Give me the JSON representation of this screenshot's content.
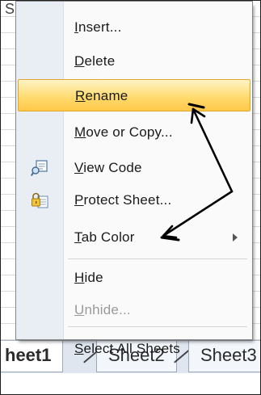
{
  "context_menu": {
    "items": [
      {
        "text": "Insert...",
        "accel": "I",
        "rest": "nsert...",
        "enabled": true
      },
      {
        "text": "Delete",
        "accel": "D",
        "rest": "elete",
        "enabled": true
      },
      {
        "text": "Rename",
        "accel": "R",
        "rest": "ename",
        "enabled": true,
        "highlighted": true
      },
      {
        "text": "Move or Copy...",
        "accel": "M",
        "rest": "ove or Copy...",
        "enabled": true
      },
      {
        "text": "View Code",
        "accel": "V",
        "rest": "iew Code",
        "enabled": true,
        "icon": "view-code-icon"
      },
      {
        "text": "Protect Sheet...",
        "accel": "P",
        "rest": "rotect Sheet...",
        "enabled": true,
        "icon": "protect-sheet-icon"
      },
      {
        "text": "Tab Color",
        "accel": "T",
        "rest": "ab Color",
        "enabled": true,
        "submenu": true
      },
      {
        "text": "Hide",
        "accel": "H",
        "rest": "ide",
        "enabled": true
      },
      {
        "text": "Unhide...",
        "accel": "U",
        "rest": "nhide...",
        "enabled": false
      },
      {
        "text": "Select All Sheets",
        "accel": "S",
        "rest": "elect All Sheets",
        "enabled": true
      }
    ]
  },
  "sheet_tabs": [
    {
      "label": "heet1",
      "active": true
    },
    {
      "label": "Sheet2",
      "active": false
    },
    {
      "label": "Sheet3",
      "active": false
    }
  ],
  "colors": {
    "highlight": "#ffd96a",
    "gutter": "#e9eef4",
    "annotation": "#000000"
  }
}
